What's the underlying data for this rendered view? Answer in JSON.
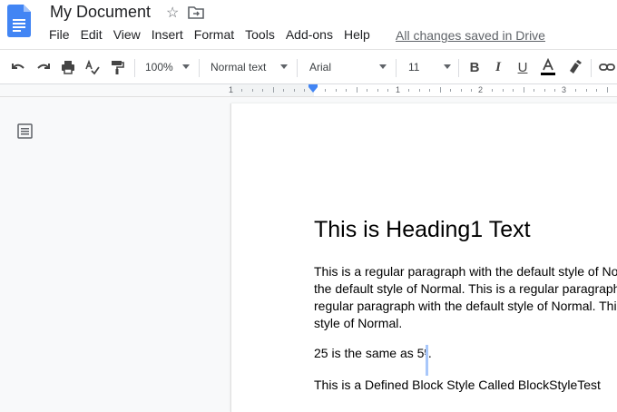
{
  "title": {
    "doc_name": "My Document",
    "saved_status": "All changes saved in Drive"
  },
  "menubar": {
    "items": [
      "File",
      "Edit",
      "View",
      "Insert",
      "Format",
      "Tools",
      "Add-ons",
      "Help"
    ]
  },
  "toolbar": {
    "zoom": "100%",
    "style": "Normal text",
    "font": "Arial",
    "font_size": "11",
    "text_color": "#000000"
  },
  "ruler": {
    "labels": [
      "1",
      "1",
      "2",
      "3"
    ]
  },
  "document": {
    "heading": "This is Heading1 Text",
    "paragraph_lines": [
      "This is a regular paragraph with the default style of No",
      "the default style of Normal. This is a regular paragraph",
      "regular paragraph with the default style of Normal. Thi",
      "style of Normal."
    ],
    "math_line_prefix": "25 is the same as 5",
    "math_superscript": "5",
    "math_line_suffix": ".",
    "block_style_line": "This is a Defined Block Style Called BlockStyleTest"
  },
  "colors": {
    "accent": "#4285f4",
    "docs_blue": "#4285f4",
    "selection": "#a8c7fa"
  },
  "icons": [
    "docs-logo-icon",
    "star-icon",
    "move-to-folder-icon",
    "undo-icon",
    "redo-icon",
    "print-icon",
    "spellcheck-icon",
    "paint-format-icon",
    "bold-icon",
    "italic-icon",
    "underline-icon",
    "text-color-icon",
    "highlight-icon",
    "link-icon",
    "document-outline-icon"
  ]
}
